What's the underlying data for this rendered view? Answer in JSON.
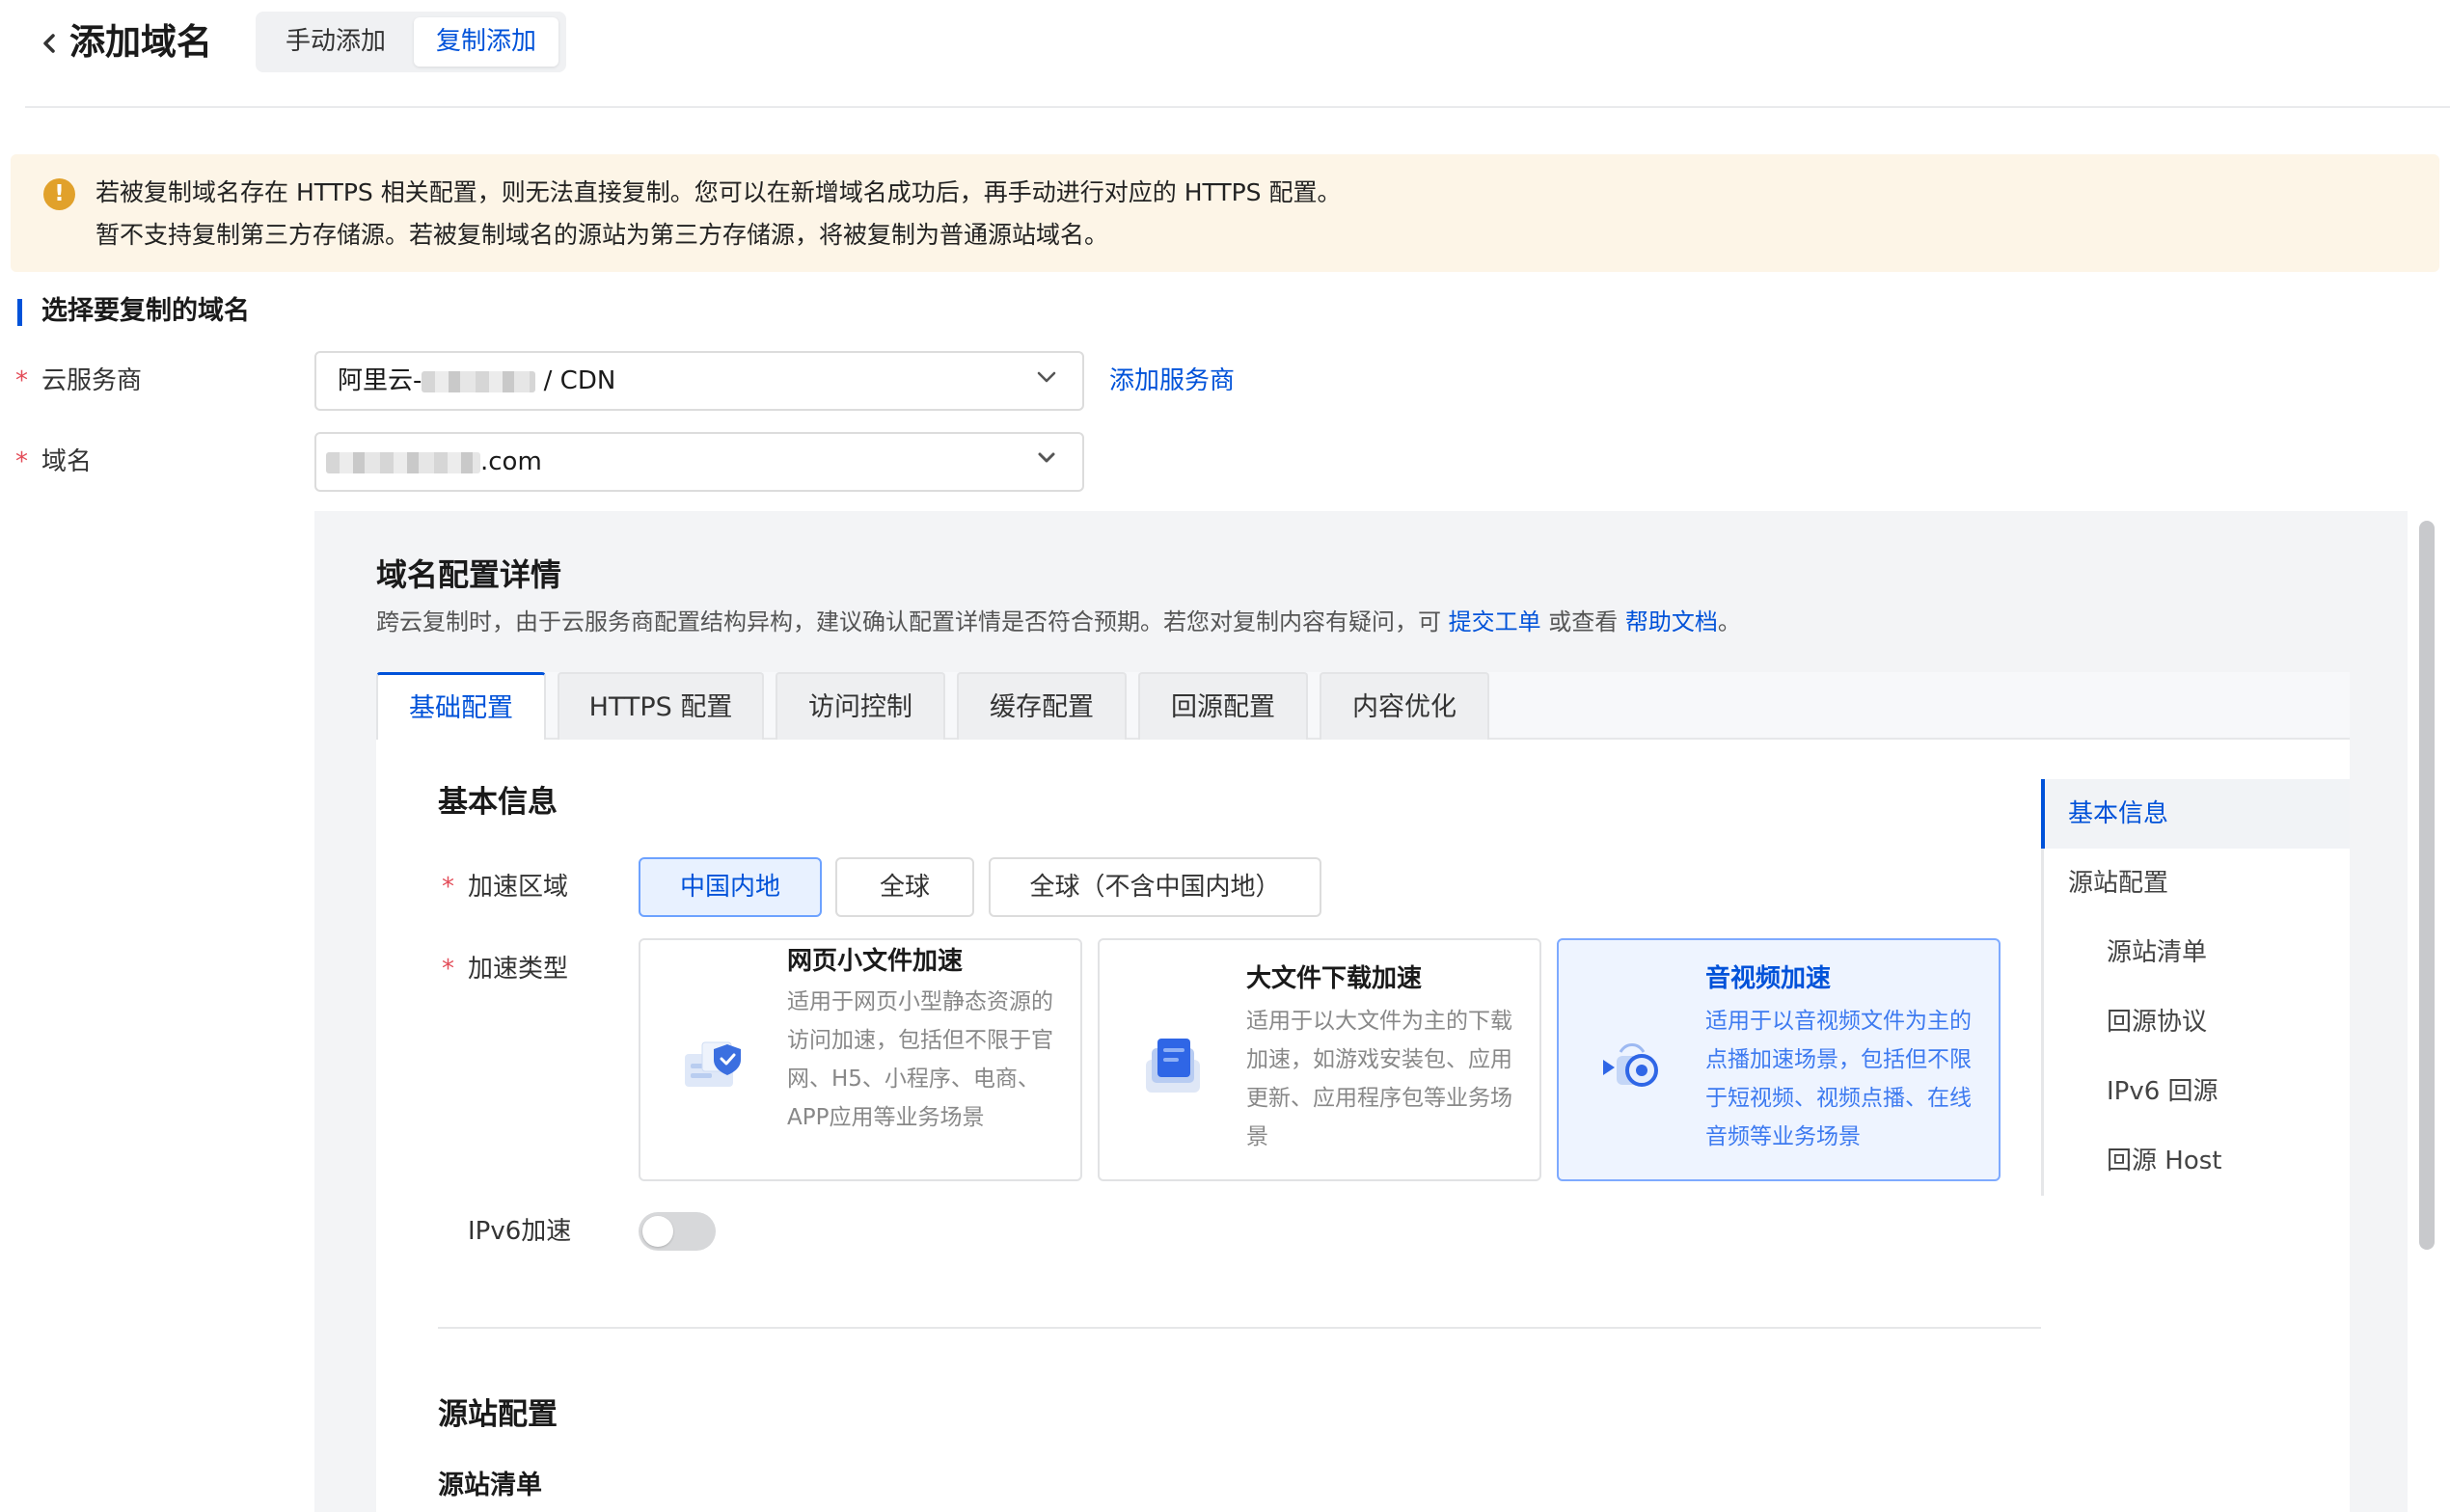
{
  "header": {
    "back_icon": "chevron-left-icon",
    "title": "添加域名",
    "modes": [
      "手动添加",
      "复制添加"
    ],
    "active_mode": "复制添加"
  },
  "notice": {
    "icon": "warning-icon",
    "lines": [
      "若被复制域名存在 HTTPS 相关配置，则无法直接复制。您可以在新增域名成功后，再手动进行对应的 HTTPS 配置。",
      "暂不支持复制第三方存储源。若被复制域名的源站为第三方存储源，将被复制为普通源站域名。"
    ]
  },
  "select_section": {
    "title": "选择要复制的域名",
    "provider": {
      "label": "云服务商",
      "prefix": "阿里云-",
      "suffix": " / CDN",
      "add_link": "添加服务商"
    },
    "domain": {
      "label": "域名",
      "suffix": ".com"
    }
  },
  "detail": {
    "title": "域名配置详情",
    "desc_prefix": "跨云复制时，由于云服务商配置结构异构，建议确认配置详情是否符合预期。若您对复制内容有疑问，可 ",
    "link_ticket": "提交工单",
    "desc_mid": " 或查看 ",
    "link_help": "帮助文档",
    "desc_suffix": "。",
    "tabs": [
      "基础配置",
      "HTTPS 配置",
      "访问控制",
      "缓存配置",
      "回源配置",
      "内容优化"
    ],
    "active_tab": "基础配置"
  },
  "basic_info": {
    "title": "基本信息",
    "region_label": "加速区域",
    "regions": [
      "中国内地",
      "全球",
      "全球（不含中国内地）"
    ],
    "active_region": "中国内地",
    "type_label": "加速类型",
    "types": [
      {
        "title": "网页小文件加速",
        "desc": "适用于网页小型静态资源的访问加速，包括但不限于官网、H5、小程序、电商、APP应用等业务场景",
        "icon": "web-shield-icon"
      },
      {
        "title": "大文件下载加速",
        "desc": "适用于以大文件为主的下载加速，如游戏安装包、应用更新、应用程序包等业务场景",
        "icon": "file-stack-icon"
      },
      {
        "title": "音视频加速",
        "desc": "适用于以音视频文件为主的点播加速场景，包括但不限于短视频、视频点播、在线音频等业务场景",
        "icon": "video-camera-icon"
      }
    ],
    "active_type": "音视频加速",
    "ipv6_label": "IPv6加速",
    "ipv6_enabled": false
  },
  "origin": {
    "title": "源站配置",
    "list_title": "源站清单"
  },
  "anchors": {
    "items": [
      "基本信息",
      "源站配置",
      "源站清单",
      "回源协议",
      "IPv6 回源",
      "回源 Host"
    ],
    "active": "基本信息"
  },
  "colors": {
    "primary": "#0052d9",
    "warning": "#e1a12b",
    "notice_bg": "#fdf5e7",
    "required": "#e34d59"
  }
}
